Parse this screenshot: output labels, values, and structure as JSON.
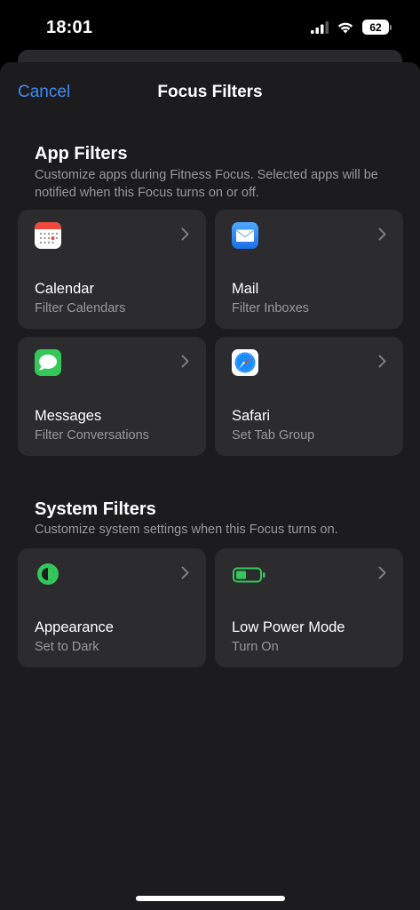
{
  "status_bar": {
    "time": "18:01",
    "battery_level": "62",
    "icons": [
      "cellular-signal-icon",
      "wifi-icon",
      "battery-icon"
    ]
  },
  "nav": {
    "cancel_label": "Cancel",
    "title": "Focus Filters"
  },
  "app_filters": {
    "title": "App Filters",
    "description": "Customize apps during Fitness Focus. Selected apps will be notified when this Focus turns on or off.",
    "items": [
      {
        "title": "Calendar",
        "subtitle": "Filter Calendars",
        "icon": "calendar-icon"
      },
      {
        "title": "Mail",
        "subtitle": "Filter Inboxes",
        "icon": "mail-icon"
      },
      {
        "title": "Messages",
        "subtitle": "Filter Conversations",
        "icon": "messages-icon"
      },
      {
        "title": "Safari",
        "subtitle": "Set Tab Group",
        "icon": "safari-icon"
      }
    ]
  },
  "system_filters": {
    "title": "System Filters",
    "description": "Customize system settings when this Focus turns on.",
    "items": [
      {
        "title": "Appearance",
        "subtitle": "Set to Dark",
        "icon": "appearance-icon"
      },
      {
        "title": "Low Power Mode",
        "subtitle": "Turn On",
        "icon": "low-power-battery-icon"
      }
    ]
  },
  "colors": {
    "accent": "#3d8cf5",
    "sheet_background": "#1c1c1e",
    "tile_background": "#2c2c2e",
    "secondary_text": "#98989e",
    "green": "#34c759"
  }
}
